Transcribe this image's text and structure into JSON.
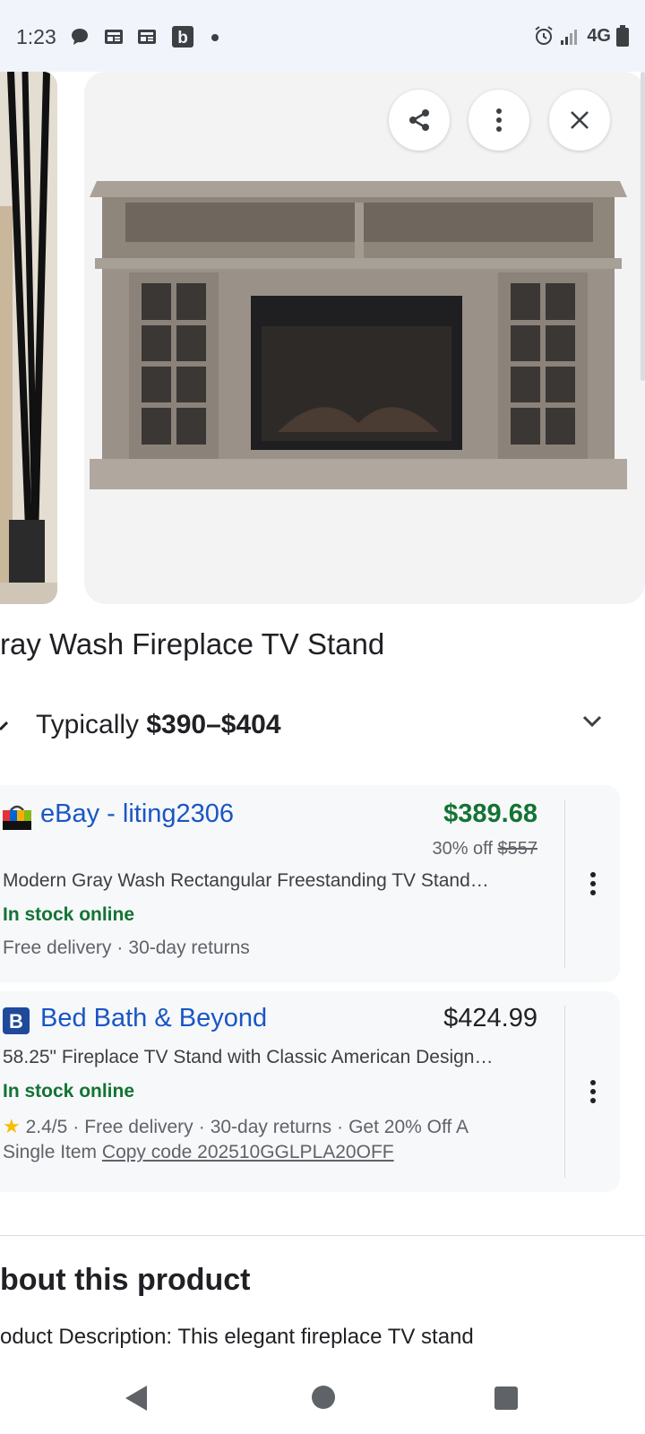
{
  "status_bar": {
    "time": "1:23",
    "network": "4G",
    "icons": [
      "chat-icon",
      "news-icon",
      "news-icon",
      "b-app-icon",
      "dot-icon",
      "alarm-icon",
      "signal-icon",
      "battery-icon"
    ]
  },
  "gallery": {
    "actions": [
      "share-icon",
      "more-vert-icon",
      "close-icon"
    ]
  },
  "product": {
    "title": "ray Wash Fireplace TV Stand",
    "typical_label": "Typically ",
    "typical_range": "$390–$404"
  },
  "offers": [
    {
      "merchant": "eBay - liting2306",
      "price": "$389.68",
      "discount_label": "30% off ",
      "original_price": "$557",
      "description": "Modern Gray Wash Rectangular Freestanding TV Stand…",
      "stock": "In stock online",
      "meta": [
        "Free delivery",
        "30-day returns"
      ]
    },
    {
      "merchant": "Bed Bath & Beyond",
      "price": "$424.99",
      "description": "58.25\" Fireplace TV Stand with Classic American Design…",
      "stock": "In stock online",
      "rating": "2.4/5",
      "meta": [
        "Free delivery",
        "30-day returns",
        "Get 20% Off A"
      ],
      "meta_line2": "Single Item",
      "coupon": "Copy code 202510GGLPLA20OFF"
    }
  ],
  "about": {
    "title": "bout this product",
    "description": "oduct Description: This elegant fireplace TV stand"
  },
  "colors": {
    "link_blue": "#1a56c4",
    "sale_green": "#137333",
    "card_bg": "#f6f8fa",
    "star": "#fbbc04"
  }
}
